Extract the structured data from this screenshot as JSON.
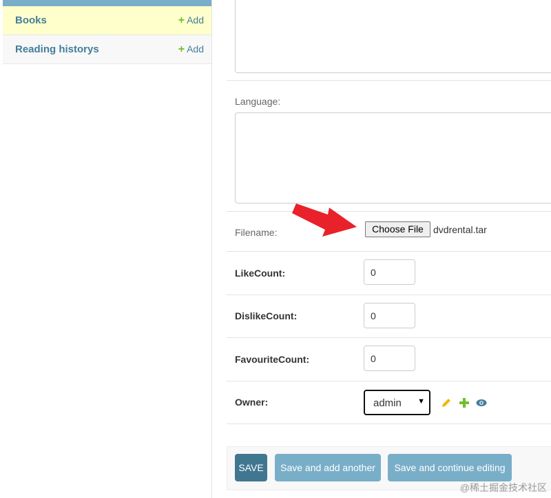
{
  "sidebar": {
    "items": [
      {
        "label": "Books",
        "add_label": "Add"
      },
      {
        "label": "Reading historys",
        "add_label": "Add"
      }
    ]
  },
  "form": {
    "language_label": "Language:",
    "filename_label": "Filename:",
    "choose_file_label": "Choose File",
    "file_name": "dvdrental.tar",
    "like_label": "LikeCount:",
    "like_value": "0",
    "dislike_label": "DislikeCount:",
    "dislike_value": "0",
    "favourite_label": "FavouriteCount:",
    "favourite_value": "0",
    "owner_label": "Owner:",
    "owner_value": "admin"
  },
  "actions": {
    "save": "SAVE",
    "save_add_another": "Save and add another",
    "save_continue": "Save and continue editing"
  },
  "watermark": "@稀土掘金技术社区",
  "colors": {
    "accent": "#79aec8",
    "primary_button": "#417690",
    "current_row": "#ffffcc",
    "add_icon": "#70bf2b",
    "arrow": "#e8212a"
  },
  "icons": [
    "plus-icon",
    "pencil-icon",
    "eye-icon",
    "chevron-down-icon",
    "red-arrow-annotation"
  ]
}
